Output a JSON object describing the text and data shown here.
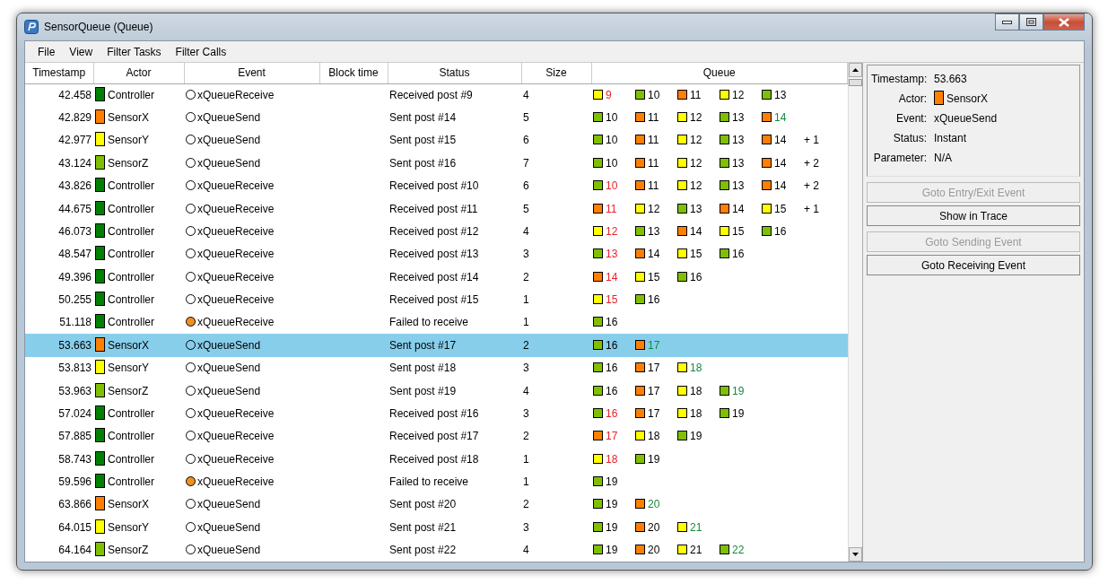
{
  "window": {
    "title": "SensorQueue (Queue)"
  },
  "menu": [
    "File",
    "View",
    "Filter Tasks",
    "Filter Calls"
  ],
  "table": {
    "columns": [
      "Timestamp",
      "Actor",
      "Event",
      "Block time",
      "Status",
      "Size",
      "Queue"
    ],
    "rows": [
      {
        "timestamp": "42.458",
        "actor": {
          "name": "Controller",
          "color": "#008000"
        },
        "event": "xQueueReceive",
        "failed": false,
        "status": "Received post #9",
        "size": "4",
        "selected": false,
        "queue": [
          {
            "number": "9",
            "color": "#ffff00",
            "kind": "received"
          },
          {
            "number": "10",
            "color": "#80c000",
            "kind": "queued"
          },
          {
            "number": "11",
            "color": "#ff8000",
            "kind": "queued"
          },
          {
            "number": "12",
            "color": "#ffff00",
            "kind": "queued"
          },
          {
            "number": "13",
            "color": "#80c000",
            "kind": "queued"
          }
        ]
      },
      {
        "timestamp": "42.829",
        "actor": {
          "name": "SensorX",
          "color": "#ff8000"
        },
        "event": "xQueueSend",
        "failed": false,
        "status": "Sent post #14",
        "size": "5",
        "selected": false,
        "queue": [
          {
            "number": "10",
            "color": "#80c000",
            "kind": "queued"
          },
          {
            "number": "11",
            "color": "#ff8000",
            "kind": "queued"
          },
          {
            "number": "12",
            "color": "#ffff00",
            "kind": "queued"
          },
          {
            "number": "13",
            "color": "#80c000",
            "kind": "queued"
          },
          {
            "number": "14",
            "color": "#ff8000",
            "kind": "sent"
          }
        ]
      },
      {
        "timestamp": "42.977",
        "actor": {
          "name": "SensorY",
          "color": "#ffff00"
        },
        "event": "xQueueSend",
        "failed": false,
        "status": "Sent post #15",
        "size": "6",
        "selected": false,
        "queue": [
          {
            "number": "10",
            "color": "#80c000",
            "kind": "queued"
          },
          {
            "number": "11",
            "color": "#ff8000",
            "kind": "queued"
          },
          {
            "number": "12",
            "color": "#ffff00",
            "kind": "queued"
          },
          {
            "number": "13",
            "color": "#80c000",
            "kind": "queued"
          },
          {
            "number": "14",
            "color": "#ff8000",
            "kind": "queued"
          }
        ],
        "more": "+ 1"
      },
      {
        "timestamp": "43.124",
        "actor": {
          "name": "SensorZ",
          "color": "#80c000"
        },
        "event": "xQueueSend",
        "failed": false,
        "status": "Sent post #16",
        "size": "7",
        "selected": false,
        "queue": [
          {
            "number": "10",
            "color": "#80c000",
            "kind": "queued"
          },
          {
            "number": "11",
            "color": "#ff8000",
            "kind": "queued"
          },
          {
            "number": "12",
            "color": "#ffff00",
            "kind": "queued"
          },
          {
            "number": "13",
            "color": "#80c000",
            "kind": "queued"
          },
          {
            "number": "14",
            "color": "#ff8000",
            "kind": "queued"
          }
        ],
        "more": "+ 2"
      },
      {
        "timestamp": "43.826",
        "actor": {
          "name": "Controller",
          "color": "#008000"
        },
        "event": "xQueueReceive",
        "failed": false,
        "status": "Received post #10",
        "size": "6",
        "selected": false,
        "queue": [
          {
            "number": "10",
            "color": "#80c000",
            "kind": "received"
          },
          {
            "number": "11",
            "color": "#ff8000",
            "kind": "queued"
          },
          {
            "number": "12",
            "color": "#ffff00",
            "kind": "queued"
          },
          {
            "number": "13",
            "color": "#80c000",
            "kind": "queued"
          },
          {
            "number": "14",
            "color": "#ff8000",
            "kind": "queued"
          }
        ],
        "more": "+ 2"
      },
      {
        "timestamp": "44.675",
        "actor": {
          "name": "Controller",
          "color": "#008000"
        },
        "event": "xQueueReceive",
        "failed": false,
        "status": "Received post #11",
        "size": "5",
        "selected": false,
        "queue": [
          {
            "number": "11",
            "color": "#ff8000",
            "kind": "received"
          },
          {
            "number": "12",
            "color": "#ffff00",
            "kind": "queued"
          },
          {
            "number": "13",
            "color": "#80c000",
            "kind": "queued"
          },
          {
            "number": "14",
            "color": "#ff8000",
            "kind": "queued"
          },
          {
            "number": "15",
            "color": "#ffff00",
            "kind": "queued"
          }
        ],
        "more": "+ 1"
      },
      {
        "timestamp": "46.073",
        "actor": {
          "name": "Controller",
          "color": "#008000"
        },
        "event": "xQueueReceive",
        "failed": false,
        "status": "Received post #12",
        "size": "4",
        "selected": false,
        "queue": [
          {
            "number": "12",
            "color": "#ffff00",
            "kind": "received"
          },
          {
            "number": "13",
            "color": "#80c000",
            "kind": "queued"
          },
          {
            "number": "14",
            "color": "#ff8000",
            "kind": "queued"
          },
          {
            "number": "15",
            "color": "#ffff00",
            "kind": "queued"
          },
          {
            "number": "16",
            "color": "#80c000",
            "kind": "queued"
          }
        ]
      },
      {
        "timestamp": "48.547",
        "actor": {
          "name": "Controller",
          "color": "#008000"
        },
        "event": "xQueueReceive",
        "failed": false,
        "status": "Received post #13",
        "size": "3",
        "selected": false,
        "queue": [
          {
            "number": "13",
            "color": "#80c000",
            "kind": "received"
          },
          {
            "number": "14",
            "color": "#ff8000",
            "kind": "queued"
          },
          {
            "number": "15",
            "color": "#ffff00",
            "kind": "queued"
          },
          {
            "number": "16",
            "color": "#80c000",
            "kind": "queued"
          }
        ]
      },
      {
        "timestamp": "49.396",
        "actor": {
          "name": "Controller",
          "color": "#008000"
        },
        "event": "xQueueReceive",
        "failed": false,
        "status": "Received post #14",
        "size": "2",
        "selected": false,
        "queue": [
          {
            "number": "14",
            "color": "#ff8000",
            "kind": "received"
          },
          {
            "number": "15",
            "color": "#ffff00",
            "kind": "queued"
          },
          {
            "number": "16",
            "color": "#80c000",
            "kind": "queued"
          }
        ]
      },
      {
        "timestamp": "50.255",
        "actor": {
          "name": "Controller",
          "color": "#008000"
        },
        "event": "xQueueReceive",
        "failed": false,
        "status": "Received post #15",
        "size": "1",
        "selected": false,
        "queue": [
          {
            "number": "15",
            "color": "#ffff00",
            "kind": "received"
          },
          {
            "number": "16",
            "color": "#80c000",
            "kind": "queued"
          }
        ]
      },
      {
        "timestamp": "51.118",
        "actor": {
          "name": "Controller",
          "color": "#008000"
        },
        "event": "xQueueReceive",
        "failed": true,
        "status": "Failed to receive",
        "size": "1",
        "selected": false,
        "queue": [
          {
            "number": "16",
            "color": "#80c000",
            "kind": "queued"
          }
        ]
      },
      {
        "timestamp": "53.663",
        "actor": {
          "name": "SensorX",
          "color": "#ff8000"
        },
        "event": "xQueueSend",
        "failed": false,
        "status": "Sent post #17",
        "size": "2",
        "selected": true,
        "queue": [
          {
            "number": "16",
            "color": "#80c000",
            "kind": "queued"
          },
          {
            "number": "17",
            "color": "#ff8000",
            "kind": "sent"
          }
        ]
      },
      {
        "timestamp": "53.813",
        "actor": {
          "name": "SensorY",
          "color": "#ffff00"
        },
        "event": "xQueueSend",
        "failed": false,
        "status": "Sent post #18",
        "size": "3",
        "selected": false,
        "queue": [
          {
            "number": "16",
            "color": "#80c000",
            "kind": "queued"
          },
          {
            "number": "17",
            "color": "#ff8000",
            "kind": "queued"
          },
          {
            "number": "18",
            "color": "#ffff00",
            "kind": "sent"
          }
        ]
      },
      {
        "timestamp": "53.963",
        "actor": {
          "name": "SensorZ",
          "color": "#80c000"
        },
        "event": "xQueueSend",
        "failed": false,
        "status": "Sent post #19",
        "size": "4",
        "selected": false,
        "queue": [
          {
            "number": "16",
            "color": "#80c000",
            "kind": "queued"
          },
          {
            "number": "17",
            "color": "#ff8000",
            "kind": "queued"
          },
          {
            "number": "18",
            "color": "#ffff00",
            "kind": "queued"
          },
          {
            "number": "19",
            "color": "#80c000",
            "kind": "sent"
          }
        ]
      },
      {
        "timestamp": "57.024",
        "actor": {
          "name": "Controller",
          "color": "#008000"
        },
        "event": "xQueueReceive",
        "failed": false,
        "status": "Received post #16",
        "size": "3",
        "selected": false,
        "queue": [
          {
            "number": "16",
            "color": "#80c000",
            "kind": "received"
          },
          {
            "number": "17",
            "color": "#ff8000",
            "kind": "queued"
          },
          {
            "number": "18",
            "color": "#ffff00",
            "kind": "queued"
          },
          {
            "number": "19",
            "color": "#80c000",
            "kind": "queued"
          }
        ]
      },
      {
        "timestamp": "57.885",
        "actor": {
          "name": "Controller",
          "color": "#008000"
        },
        "event": "xQueueReceive",
        "failed": false,
        "status": "Received post #17",
        "size": "2",
        "selected": false,
        "queue": [
          {
            "number": "17",
            "color": "#ff8000",
            "kind": "received"
          },
          {
            "number": "18",
            "color": "#ffff00",
            "kind": "queued"
          },
          {
            "number": "19",
            "color": "#80c000",
            "kind": "queued"
          }
        ]
      },
      {
        "timestamp": "58.743",
        "actor": {
          "name": "Controller",
          "color": "#008000"
        },
        "event": "xQueueReceive",
        "failed": false,
        "status": "Received post #18",
        "size": "1",
        "selected": false,
        "queue": [
          {
            "number": "18",
            "color": "#ffff00",
            "kind": "received"
          },
          {
            "number": "19",
            "color": "#80c000",
            "kind": "queued"
          }
        ]
      },
      {
        "timestamp": "59.596",
        "actor": {
          "name": "Controller",
          "color": "#008000"
        },
        "event": "xQueueReceive",
        "failed": true,
        "status": "Failed to receive",
        "size": "1",
        "selected": false,
        "queue": [
          {
            "number": "19",
            "color": "#80c000",
            "kind": "queued"
          }
        ]
      },
      {
        "timestamp": "63.866",
        "actor": {
          "name": "SensorX",
          "color": "#ff8000"
        },
        "event": "xQueueSend",
        "failed": false,
        "status": "Sent post #20",
        "size": "2",
        "selected": false,
        "queue": [
          {
            "number": "19",
            "color": "#80c000",
            "kind": "queued"
          },
          {
            "number": "20",
            "color": "#ff8000",
            "kind": "sent"
          }
        ]
      },
      {
        "timestamp": "64.015",
        "actor": {
          "name": "SensorY",
          "color": "#ffff00"
        },
        "event": "xQueueSend",
        "failed": false,
        "status": "Sent post #21",
        "size": "3",
        "selected": false,
        "queue": [
          {
            "number": "19",
            "color": "#80c000",
            "kind": "queued"
          },
          {
            "number": "20",
            "color": "#ff8000",
            "kind": "queued"
          },
          {
            "number": "21",
            "color": "#ffff00",
            "kind": "sent"
          }
        ]
      },
      {
        "timestamp": "64.164",
        "actor": {
          "name": "SensorZ",
          "color": "#80c000"
        },
        "event": "xQueueSend",
        "failed": false,
        "status": "Sent post #22",
        "size": "4",
        "selected": false,
        "queue": [
          {
            "number": "19",
            "color": "#80c000",
            "kind": "queued"
          },
          {
            "number": "20",
            "color": "#ff8000",
            "kind": "queued"
          },
          {
            "number": "21",
            "color": "#ffff00",
            "kind": "queued"
          },
          {
            "number": "22",
            "color": "#80c000",
            "kind": "sent"
          }
        ]
      }
    ]
  },
  "details": {
    "fields": [
      {
        "label": "Timestamp:",
        "value": "53.663"
      },
      {
        "label": "Actor:",
        "value": "SensorX",
        "color": "#ff8000"
      },
      {
        "label": "Event:",
        "value": "xQueueSend"
      },
      {
        "label": "Status:",
        "value": "Instant"
      },
      {
        "label": "Parameter:",
        "value": "N/A"
      }
    ],
    "buttons": [
      {
        "label": "Goto Entry/Exit Event",
        "disabled": true
      },
      {
        "label": "Show in Trace",
        "disabled": false
      },
      {
        "label": "Goto Sending Event",
        "disabled": true
      },
      {
        "label": "Goto Receiving Event",
        "disabled": false
      }
    ]
  }
}
